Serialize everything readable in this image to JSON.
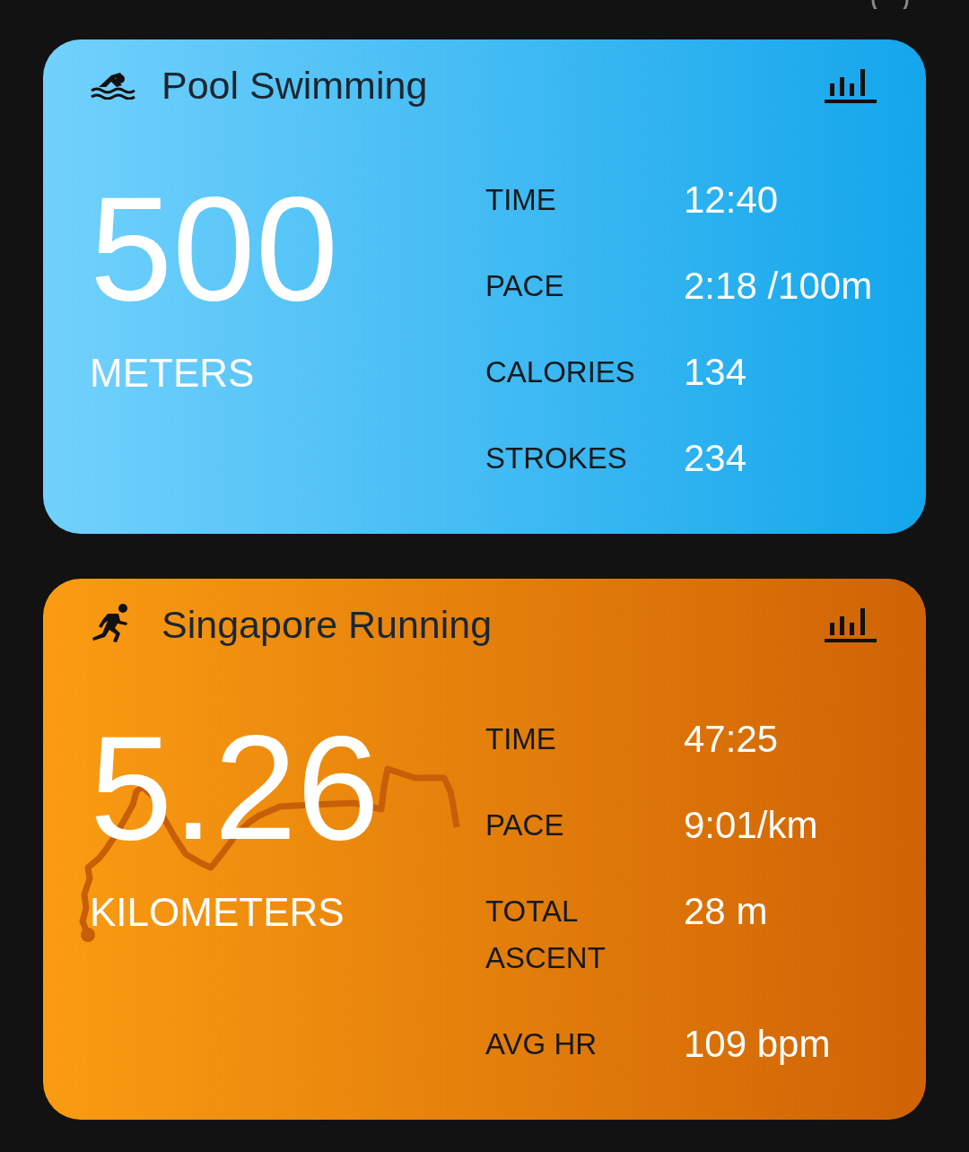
{
  "activities": [
    {
      "kind": "swim",
      "title": "Pool Swimming",
      "distance": "500",
      "unit": "METERS",
      "stats": [
        {
          "label": "TIME",
          "value": "12:40"
        },
        {
          "label": "PACE",
          "value": "2:18 /100m"
        },
        {
          "label": "CALORIES",
          "value": "134"
        },
        {
          "label": "STROKES",
          "value": "234"
        }
      ]
    },
    {
      "kind": "run",
      "title": "Singapore Running",
      "distance": "5.26",
      "unit": "KILOMETERS",
      "stats": [
        {
          "label": "TIME",
          "value": "47:25"
        },
        {
          "label": "PACE",
          "value": "9:01/km"
        },
        {
          "label": "TOTAL ASCENT",
          "value": "28 m"
        },
        {
          "label": "AVG HR",
          "value": "109 bpm"
        }
      ]
    }
  ]
}
